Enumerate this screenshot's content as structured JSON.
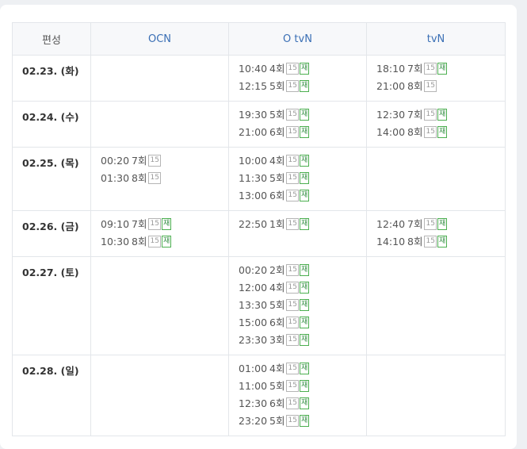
{
  "header": {
    "date_col": "편성",
    "channels": [
      "OCN",
      "O tvN",
      "tvN"
    ]
  },
  "rows": [
    {
      "date": "02.23. (화)",
      "cells": [
        [],
        [
          {
            "time": "10:40",
            "ep": "4회",
            "rating": "15",
            "rerun": "재"
          },
          {
            "time": "12:15",
            "ep": "5회",
            "rating": "15",
            "rerun": "재"
          }
        ],
        [
          {
            "time": "18:10",
            "ep": "7회",
            "rating": "15",
            "rerun": "재"
          },
          {
            "time": "21:00",
            "ep": "8회",
            "rating": "15",
            "rerun": ""
          }
        ]
      ]
    },
    {
      "date": "02.24. (수)",
      "cells": [
        [],
        [
          {
            "time": "19:30",
            "ep": "5회",
            "rating": "15",
            "rerun": "재"
          },
          {
            "time": "21:00",
            "ep": "6회",
            "rating": "15",
            "rerun": "재"
          }
        ],
        [
          {
            "time": "12:30",
            "ep": "7회",
            "rating": "15",
            "rerun": "재"
          },
          {
            "time": "14:00",
            "ep": "8회",
            "rating": "15",
            "rerun": "재"
          }
        ]
      ]
    },
    {
      "date": "02.25. (목)",
      "cells": [
        [
          {
            "time": "00:20",
            "ep": "7회",
            "rating": "15",
            "rerun": ""
          },
          {
            "time": "01:30",
            "ep": "8회",
            "rating": "15",
            "rerun": ""
          }
        ],
        [
          {
            "time": "10:00",
            "ep": "4회",
            "rating": "15",
            "rerun": "재"
          },
          {
            "time": "11:30",
            "ep": "5회",
            "rating": "15",
            "rerun": "재"
          },
          {
            "time": "13:00",
            "ep": "6회",
            "rating": "15",
            "rerun": "재"
          }
        ],
        []
      ]
    },
    {
      "date": "02.26. (금)",
      "cells": [
        [
          {
            "time": "09:10",
            "ep": "7회",
            "rating": "15",
            "rerun": "재"
          },
          {
            "time": "10:30",
            "ep": "8회",
            "rating": "15",
            "rerun": "재"
          }
        ],
        [
          {
            "time": "22:50",
            "ep": "1회",
            "rating": "15",
            "rerun": "재"
          }
        ],
        [
          {
            "time": "12:40",
            "ep": "7회",
            "rating": "15",
            "rerun": "재"
          },
          {
            "time": "14:10",
            "ep": "8회",
            "rating": "15",
            "rerun": "재"
          }
        ]
      ]
    },
    {
      "date": "02.27. (토)",
      "cells": [
        [],
        [
          {
            "time": "00:20",
            "ep": "2회",
            "rating": "15",
            "rerun": "재"
          },
          {
            "time": "12:00",
            "ep": "4회",
            "rating": "15",
            "rerun": "재"
          },
          {
            "time": "13:30",
            "ep": "5회",
            "rating": "15",
            "rerun": "재"
          },
          {
            "time": "15:00",
            "ep": "6회",
            "rating": "15",
            "rerun": "재"
          },
          {
            "time": "23:30",
            "ep": "3회",
            "rating": "15",
            "rerun": "재"
          }
        ],
        []
      ]
    },
    {
      "date": "02.28. (일)",
      "cells": [
        [],
        [
          {
            "time": "01:00",
            "ep": "4회",
            "rating": "15",
            "rerun": "재"
          },
          {
            "time": "11:00",
            "ep": "5회",
            "rating": "15",
            "rerun": "재"
          },
          {
            "time": "12:30",
            "ep": "6회",
            "rating": "15",
            "rerun": "재"
          },
          {
            "time": "23:20",
            "ep": "5회",
            "rating": "15",
            "rerun": "재"
          }
        ],
        []
      ]
    }
  ]
}
